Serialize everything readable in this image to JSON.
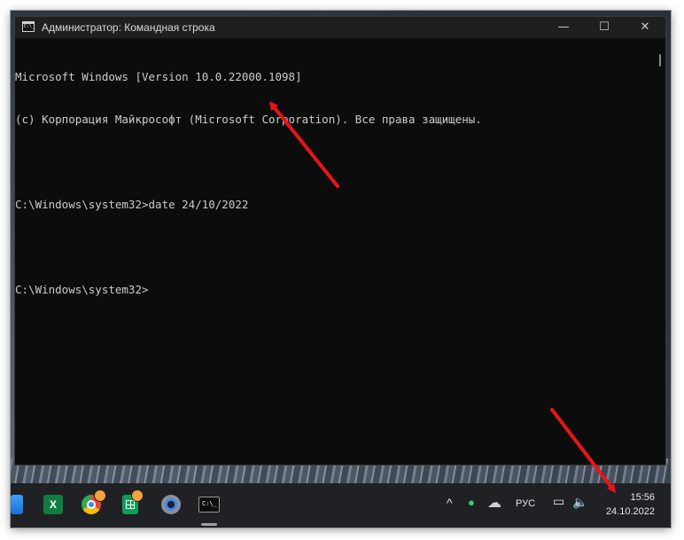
{
  "window": {
    "title": "Администратор: Командная строка",
    "minimize_glyph": "—",
    "maximize_glyph": "☐",
    "close_glyph": "✕"
  },
  "console": {
    "lines": [
      "Microsoft Windows [Version 10.0.22000.1098]",
      "(c) Корпорация Майкрософт (Microsoft Corporation). Все права защищены.",
      "",
      "C:\\Windows\\system32>date 24/10/2022",
      "",
      "C:\\Windows\\system32>"
    ]
  },
  "taskbar": {
    "apps": [
      "windows-start-icon",
      "excel-icon",
      "chrome-icon",
      "sheets-icon",
      "settings-gear-icon",
      "cmd-icon"
    ],
    "tray": {
      "chevron": "^",
      "language": "РУС"
    },
    "clock": {
      "time": "15:56",
      "date": "24.10.2022"
    }
  },
  "colors": {
    "console_bg": "#0c0c0c",
    "console_text": "#cccccc",
    "titlebar_bg": "#1f1f1f",
    "taskbar_bg": "#202124",
    "annotation_arrow": "#e8141b"
  }
}
